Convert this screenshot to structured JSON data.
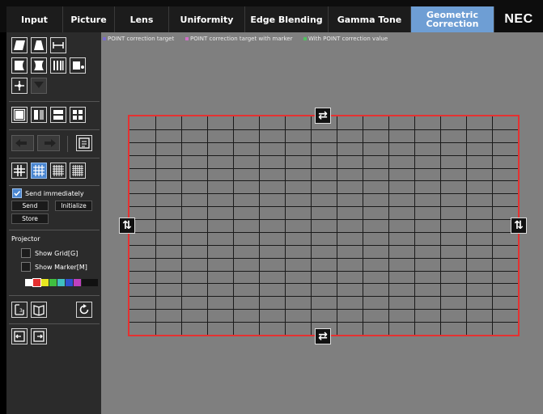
{
  "tabs": [
    {
      "label": "Input",
      "active": false
    },
    {
      "label": "Picture",
      "active": false
    },
    {
      "label": "Lens",
      "active": false
    },
    {
      "label": "Uniformity",
      "active": false
    },
    {
      "label": "Edge Blending",
      "active": false
    },
    {
      "label": "Gamma Tone",
      "active": false
    },
    {
      "label": "Geometric Correction",
      "active": true
    }
  ],
  "brand": "NEC",
  "legend": [
    {
      "label": "POINT correction target",
      "color": "#7a6bd0"
    },
    {
      "label": "POINT correction target with marker",
      "color": "#d070c8"
    },
    {
      "label": "With POINT correction value",
      "color": "#50c060"
    }
  ],
  "sidebar": {
    "send_immediately_label": "Send immediately",
    "send_immediately_checked": true,
    "send_label": "Send",
    "initialize_label": "Initialize",
    "store_label": "Store",
    "projector_heading": "Projector",
    "show_grid_label": "Show Grid[G]",
    "show_marker_label": "Show Marker[M]",
    "show_grid_checked": false,
    "show_marker_checked": false,
    "swatches": [
      "#ffffff",
      "#e53131",
      "#e8e820",
      "#40c040",
      "#40c0c0",
      "#3050d0",
      "#c040c0",
      "#111111"
    ],
    "selected_swatch": 1
  },
  "grid": {
    "columns": 15,
    "rows": 17,
    "border_color": "#e53131",
    "line_color": "#1a1a1a"
  },
  "icons": {
    "edge_arrows": [
      "swap-horizontal-icon",
      "swap-vertical-icon"
    ]
  }
}
